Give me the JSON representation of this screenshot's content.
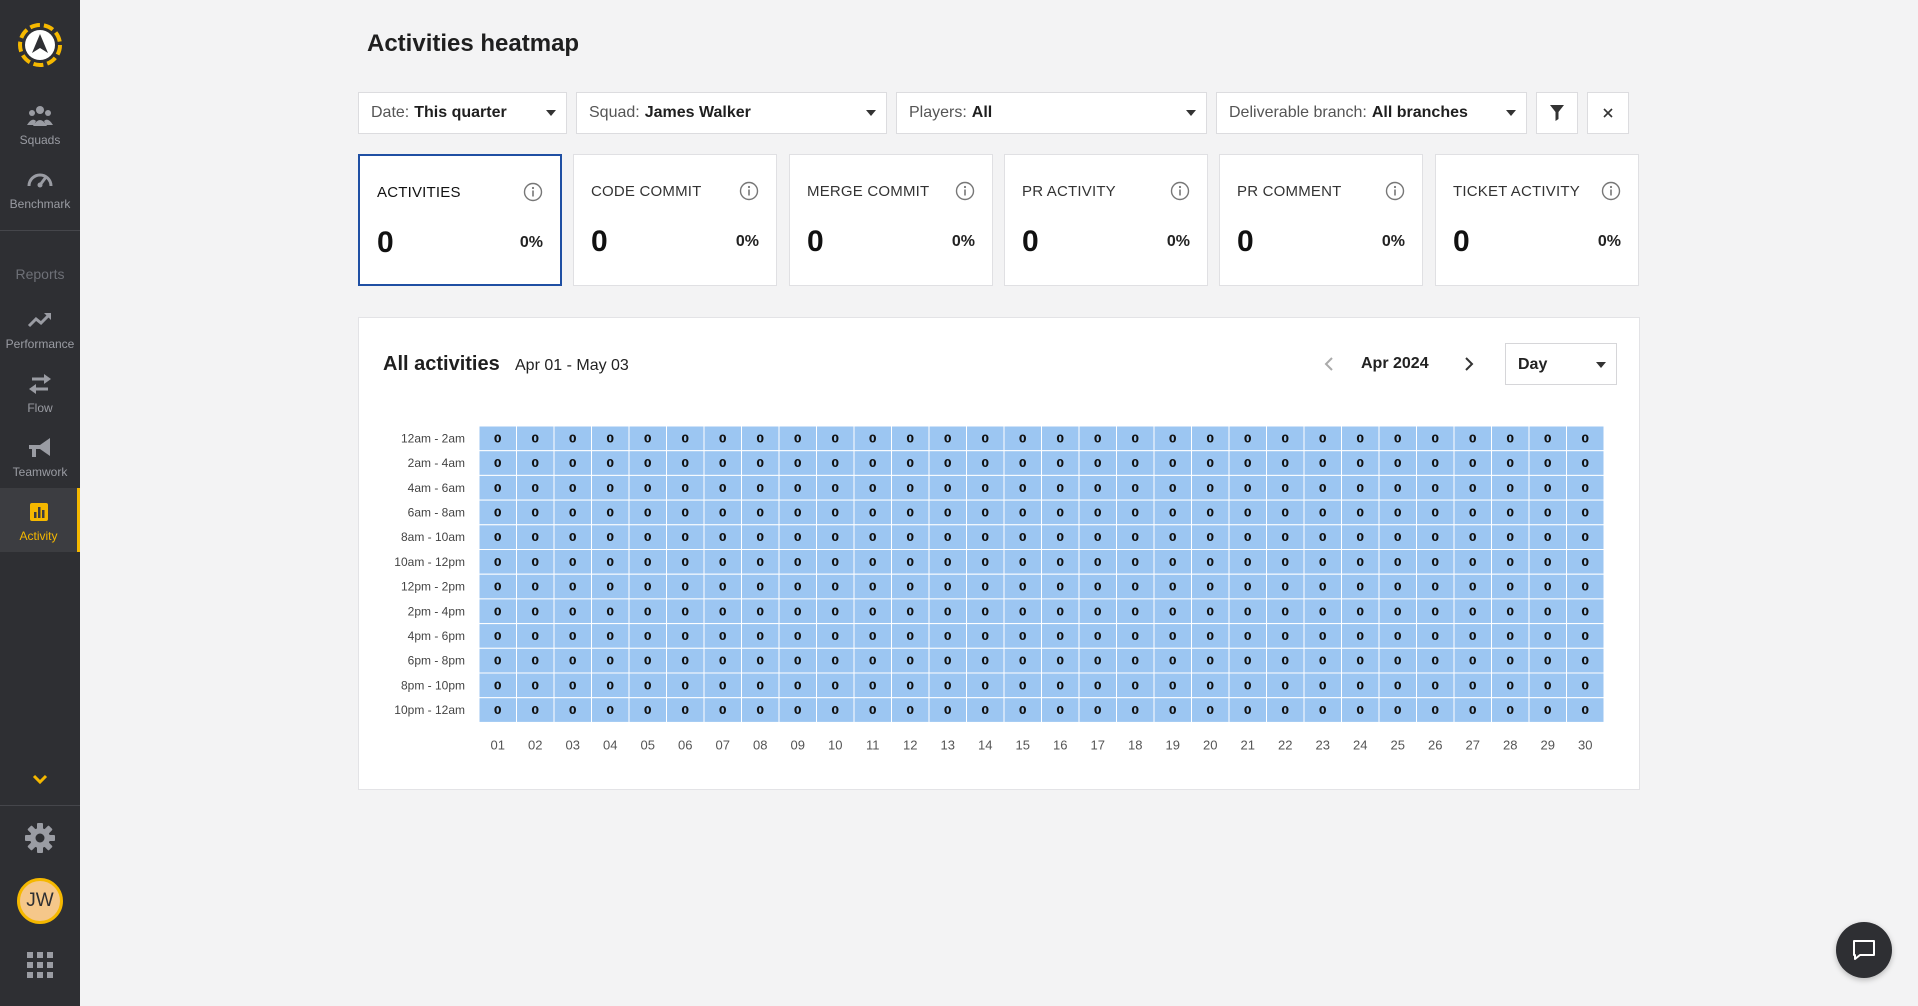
{
  "sidebar": {
    "items": [
      {
        "label": "Squads",
        "icon": "squads-icon"
      },
      {
        "label": "Benchmark",
        "icon": "benchmark-icon"
      },
      {
        "label": "Performance",
        "icon": "performance-icon"
      },
      {
        "label": "Flow",
        "icon": "flow-icon"
      },
      {
        "label": "Teamwork",
        "icon": "teamwork-icon"
      },
      {
        "label": "Activity",
        "icon": "activity-icon"
      }
    ],
    "section_label": "Reports",
    "active_item": "Activity",
    "avatar_initials": "JW",
    "accent_color": "#f5b800"
  },
  "header": {
    "title": "Activities heatmap"
  },
  "filters": {
    "date": {
      "label": "Date:",
      "value": "This quarter"
    },
    "squad": {
      "label": "Squad:",
      "value": "James Walker"
    },
    "players": {
      "label": "Players:",
      "value": "All"
    },
    "branch": {
      "label": "Deliverable branch:",
      "value": "All branches"
    }
  },
  "cards": [
    {
      "title": "ACTIVITIES",
      "value": "0",
      "pct": "0%"
    },
    {
      "title": "CODE COMMIT",
      "value": "0",
      "pct": "0%"
    },
    {
      "title": "MERGE COMMIT",
      "value": "0",
      "pct": "0%"
    },
    {
      "title": "PR ACTIVITY",
      "value": "0",
      "pct": "0%"
    },
    {
      "title": "PR COMMENT",
      "value": "0",
      "pct": "0%"
    },
    {
      "title": "TICKET ACTIVITY",
      "value": "0",
      "pct": "0%"
    }
  ],
  "panel": {
    "title": "All activities",
    "range": "Apr 01 - May 03",
    "month": "Apr 2024",
    "granularity": "Day"
  },
  "chart_data": {
    "type": "heatmap",
    "title": "All activities",
    "rows": [
      "12am - 2am",
      "2am - 4am",
      "4am - 6am",
      "6am - 8am",
      "8am - 10am",
      "10am - 12pm",
      "12pm - 2pm",
      "2pm - 4pm",
      "4pm - 6pm",
      "6pm - 8pm",
      "8pm - 10pm",
      "10pm - 12am"
    ],
    "columns": [
      "01",
      "02",
      "03",
      "04",
      "05",
      "06",
      "07",
      "08",
      "09",
      "10",
      "11",
      "12",
      "13",
      "14",
      "15",
      "16",
      "17",
      "18",
      "19",
      "20",
      "21",
      "22",
      "23",
      "24",
      "25",
      "26",
      "27",
      "28",
      "29",
      "30"
    ],
    "values": [
      [
        0,
        0,
        0,
        0,
        0,
        0,
        0,
        0,
        0,
        0,
        0,
        0,
        0,
        0,
        0,
        0,
        0,
        0,
        0,
        0,
        0,
        0,
        0,
        0,
        0,
        0,
        0,
        0,
        0,
        0
      ],
      [
        0,
        0,
        0,
        0,
        0,
        0,
        0,
        0,
        0,
        0,
        0,
        0,
        0,
        0,
        0,
        0,
        0,
        0,
        0,
        0,
        0,
        0,
        0,
        0,
        0,
        0,
        0,
        0,
        0,
        0
      ],
      [
        0,
        0,
        0,
        0,
        0,
        0,
        0,
        0,
        0,
        0,
        0,
        0,
        0,
        0,
        0,
        0,
        0,
        0,
        0,
        0,
        0,
        0,
        0,
        0,
        0,
        0,
        0,
        0,
        0,
        0
      ],
      [
        0,
        0,
        0,
        0,
        0,
        0,
        0,
        0,
        0,
        0,
        0,
        0,
        0,
        0,
        0,
        0,
        0,
        0,
        0,
        0,
        0,
        0,
        0,
        0,
        0,
        0,
        0,
        0,
        0,
        0
      ],
      [
        0,
        0,
        0,
        0,
        0,
        0,
        0,
        0,
        0,
        0,
        0,
        0,
        0,
        0,
        0,
        0,
        0,
        0,
        0,
        0,
        0,
        0,
        0,
        0,
        0,
        0,
        0,
        0,
        0,
        0
      ],
      [
        0,
        0,
        0,
        0,
        0,
        0,
        0,
        0,
        0,
        0,
        0,
        0,
        0,
        0,
        0,
        0,
        0,
        0,
        0,
        0,
        0,
        0,
        0,
        0,
        0,
        0,
        0,
        0,
        0,
        0
      ],
      [
        0,
        0,
        0,
        0,
        0,
        0,
        0,
        0,
        0,
        0,
        0,
        0,
        0,
        0,
        0,
        0,
        0,
        0,
        0,
        0,
        0,
        0,
        0,
        0,
        0,
        0,
        0,
        0,
        0,
        0
      ],
      [
        0,
        0,
        0,
        0,
        0,
        0,
        0,
        0,
        0,
        0,
        0,
        0,
        0,
        0,
        0,
        0,
        0,
        0,
        0,
        0,
        0,
        0,
        0,
        0,
        0,
        0,
        0,
        0,
        0,
        0
      ],
      [
        0,
        0,
        0,
        0,
        0,
        0,
        0,
        0,
        0,
        0,
        0,
        0,
        0,
        0,
        0,
        0,
        0,
        0,
        0,
        0,
        0,
        0,
        0,
        0,
        0,
        0,
        0,
        0,
        0,
        0
      ],
      [
        0,
        0,
        0,
        0,
        0,
        0,
        0,
        0,
        0,
        0,
        0,
        0,
        0,
        0,
        0,
        0,
        0,
        0,
        0,
        0,
        0,
        0,
        0,
        0,
        0,
        0,
        0,
        0,
        0,
        0
      ],
      [
        0,
        0,
        0,
        0,
        0,
        0,
        0,
        0,
        0,
        0,
        0,
        0,
        0,
        0,
        0,
        0,
        0,
        0,
        0,
        0,
        0,
        0,
        0,
        0,
        0,
        0,
        0,
        0,
        0,
        0
      ],
      [
        0,
        0,
        0,
        0,
        0,
        0,
        0,
        0,
        0,
        0,
        0,
        0,
        0,
        0,
        0,
        0,
        0,
        0,
        0,
        0,
        0,
        0,
        0,
        0,
        0,
        0,
        0,
        0,
        0,
        0
      ]
    ],
    "cell_color": "#9cc6f2",
    "grid": true
  }
}
